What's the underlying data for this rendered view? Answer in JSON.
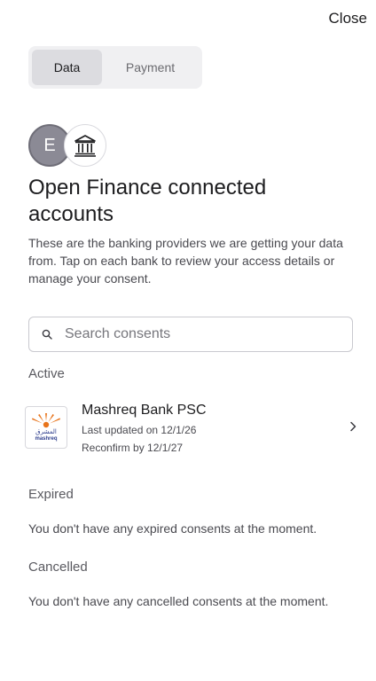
{
  "header": {
    "close_label": "Close"
  },
  "tabs": [
    {
      "label": "Data",
      "active": true
    },
    {
      "label": "Payment",
      "active": false
    }
  ],
  "avatar": {
    "initial": "E"
  },
  "icons": {
    "bank": "bank-building-icon",
    "search": "search-icon",
    "chevron": "chevron-right-icon"
  },
  "title": "Open Finance connected accounts",
  "description": "These are the banking providers we are getting your data from. Tap on each bank to review your access details or manage your consent.",
  "search": {
    "placeholder": "Search consents",
    "value": ""
  },
  "sections": {
    "active": {
      "label": "Active",
      "items": [
        {
          "name": "Mashreq Bank PSC",
          "last_updated": "Last updated on 12/1/26",
          "reconfirm": "Reconfirm by 12/1/27",
          "logo": {
            "arabic": "المشرق",
            "latin": "mashreq"
          }
        }
      ]
    },
    "expired": {
      "label": "Expired",
      "empty_text": "You don't have any expired consents at the moment."
    },
    "cancelled": {
      "label": "Cancelled",
      "empty_text": "You don't have any cancelled consents at the moment."
    }
  },
  "colors": {
    "avatar_bg": "#8b8a95",
    "tab_active_bg": "#dcdce0",
    "tab_bar_bg": "#f0f0f2",
    "logo_orange": "#e8731a",
    "logo_blue": "#2d3d8c"
  }
}
